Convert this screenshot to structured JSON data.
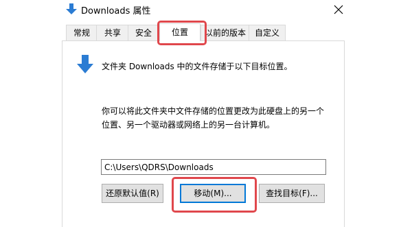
{
  "window": {
    "title": "Downloads 属性",
    "icon": "download-arrow-icon"
  },
  "tabs": [
    {
      "label": "常规"
    },
    {
      "label": "共享"
    },
    {
      "label": "安全"
    },
    {
      "label": "位置",
      "active": true
    },
    {
      "label": "以前的版本"
    },
    {
      "label": "自定义"
    }
  ],
  "location": {
    "description": "文件夹 Downloads 中的文件存储于以下目标位置。",
    "info_line1": "你可以将此文件夹中文件存储的位置更改为此硬盘上的另一个",
    "info_line2": "位置、另一个驱动器或网络上的另一台计算机。",
    "path_value": "C:\\Users\\QDRS\\Downloads"
  },
  "buttons": {
    "restore_default": "还原默认值(R)",
    "move": "移动(M)...",
    "find_target": "查找目标(F)..."
  },
  "colors": {
    "accent_blue": "#2b7cd3",
    "highlight_red": "#e0474c"
  }
}
